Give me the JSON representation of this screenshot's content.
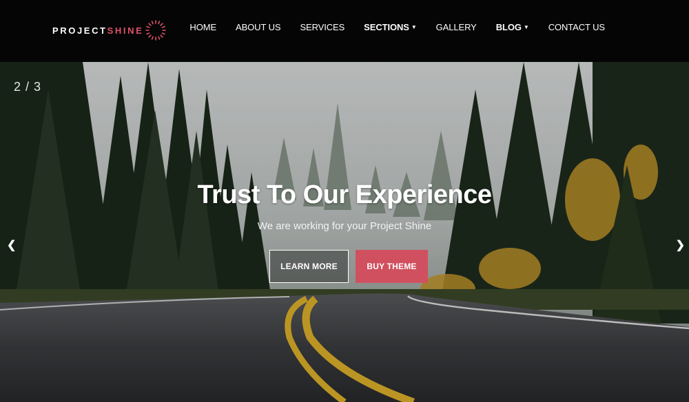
{
  "logo": {
    "text_main": "PROJECT",
    "text_accent": "SHINE",
    "icon": "sun-burst-icon",
    "accent_color": "#e0516a"
  },
  "nav": {
    "items": [
      {
        "label": "HOME",
        "has_dropdown": false
      },
      {
        "label": "ABOUT US",
        "has_dropdown": false
      },
      {
        "label": "SERVICES",
        "has_dropdown": false
      },
      {
        "label": "SECTIONS",
        "has_dropdown": true
      },
      {
        "label": "GALLERY",
        "has_dropdown": false
      },
      {
        "label": "BLOG",
        "has_dropdown": true
      },
      {
        "label": "CONTACT US",
        "has_dropdown": false
      }
    ],
    "dropdown_icon": "caret-down-icon"
  },
  "slider": {
    "counter": "2 / 3",
    "prev_icon": "chevron-left-icon",
    "next_icon": "chevron-right-icon",
    "prev_glyph": "❮",
    "next_glyph": "❯",
    "headline": "Trust To Our Experience",
    "subline": "We are working for your Project Shine",
    "buttons": {
      "learn_more": "LEARN MORE",
      "buy_theme": "BUY THEME"
    },
    "buy_color": "#d0505f"
  }
}
